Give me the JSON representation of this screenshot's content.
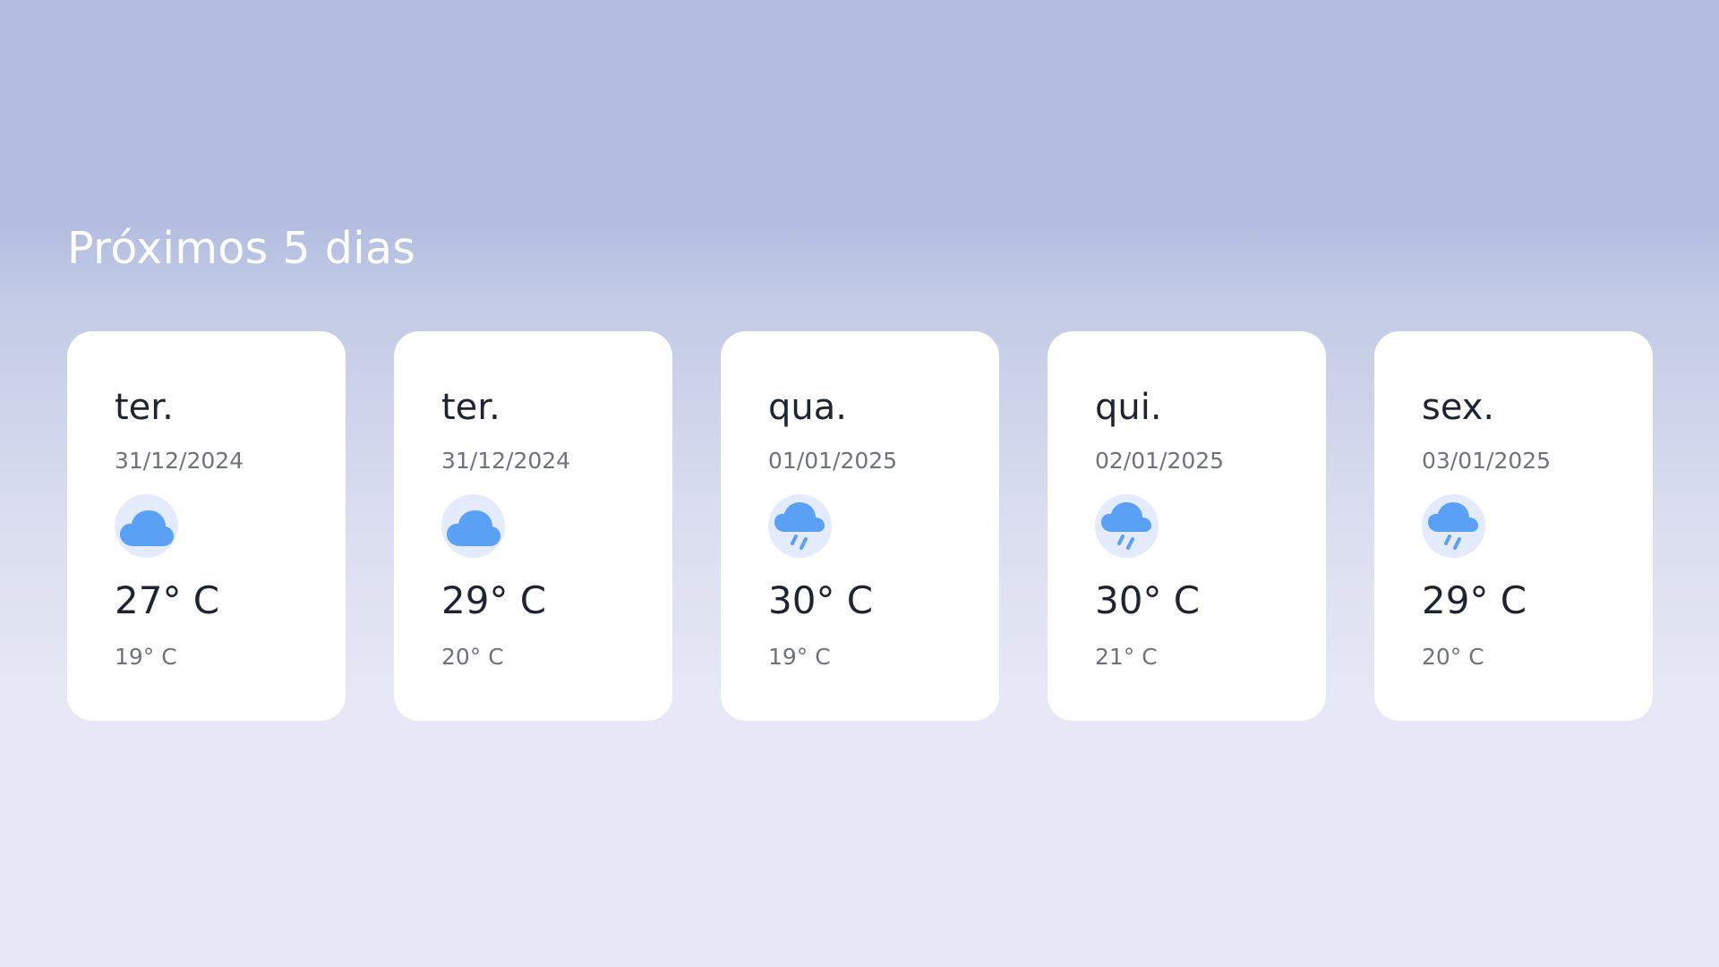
{
  "section": {
    "title": "Próximos 5 dias"
  },
  "accent_color": "#5aa0f5",
  "days": [
    {
      "day": "ter.",
      "date": "31/12/2024",
      "icon": "cloud-icon",
      "max": "27° C",
      "min": "19° C"
    },
    {
      "day": "ter.",
      "date": "31/12/2024",
      "icon": "cloud-icon",
      "max": "29° C",
      "min": "20° C"
    },
    {
      "day": "qua.",
      "date": "01/01/2025",
      "icon": "cloud-rain-icon",
      "max": "30° C",
      "min": "19° C"
    },
    {
      "day": "qui.",
      "date": "02/01/2025",
      "icon": "cloud-rain-icon",
      "max": "30° C",
      "min": "21° C"
    },
    {
      "day": "sex.",
      "date": "03/01/2025",
      "icon": "cloud-rain-icon",
      "max": "29° C",
      "min": "20° C"
    }
  ]
}
